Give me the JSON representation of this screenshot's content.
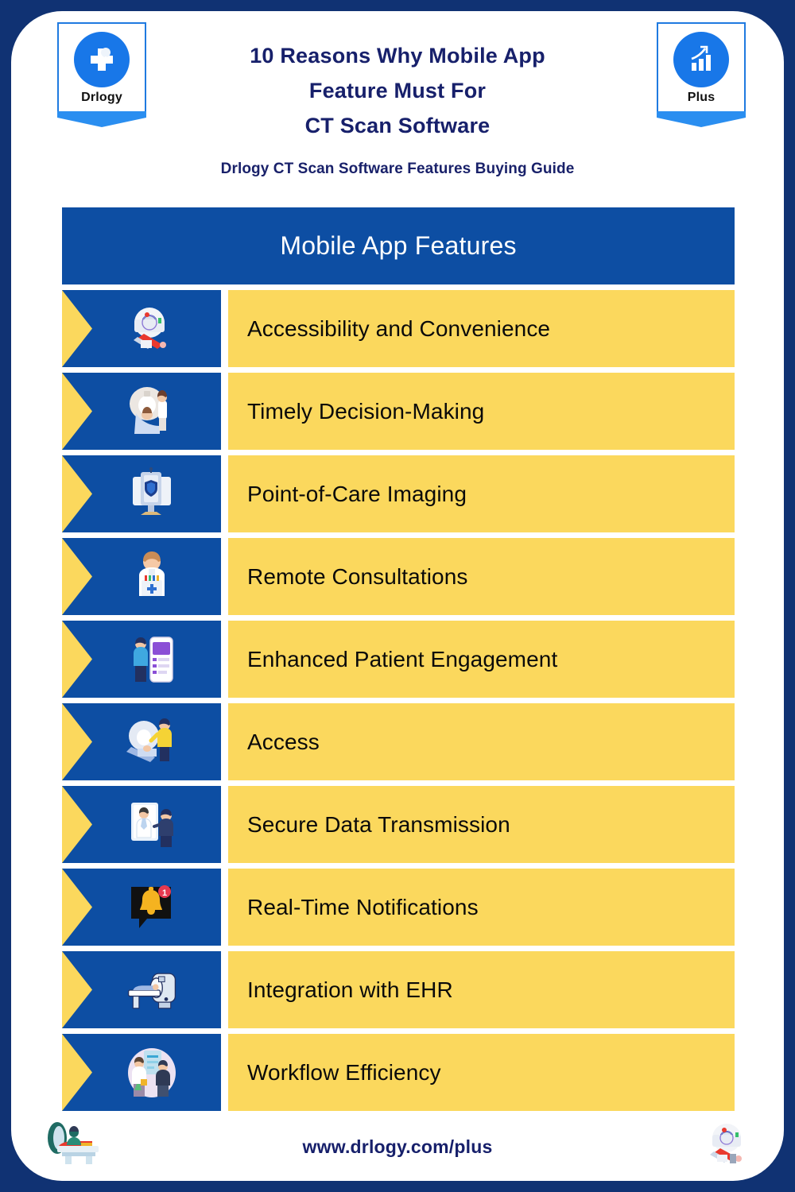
{
  "theme": {
    "outer_border": "#103273",
    "card_bg": "#ffffff",
    "header_blue": "#0d4ea3",
    "row_yellow": "#fbd85d",
    "title_navy": "#17206b",
    "badge_blue": "#1877e8"
  },
  "header": {
    "title_lines": [
      "10 Reasons Why Mobile App",
      "Feature Must For",
      "CT Scan Software"
    ],
    "subtitle": "Drlogy CT Scan Software Features Buying Guide",
    "left_badge": {
      "name": "Drlogy",
      "icon": "medical-cross-stethoscope-icon"
    },
    "right_badge": {
      "name": "Plus",
      "icon": "growth-bar-chart-arrow-icon"
    }
  },
  "table": {
    "header_label": "Mobile App Features",
    "rows": [
      {
        "label": "Accessibility and Convenience",
        "icon": "ct-scanner-patient-icon"
      },
      {
        "label": "Timely Decision-Making",
        "icon": "ct-scanner-technician-icon"
      },
      {
        "label": "Point-of-Care Imaging",
        "icon": "monitor-secure-scan-icon"
      },
      {
        "label": "Remote Consultations",
        "icon": "doctor-medical-kit-icon"
      },
      {
        "label": "Enhanced Patient Engagement",
        "icon": "mobile-app-patient-icon"
      },
      {
        "label": "Access",
        "icon": "ct-scanner-nurse-icon"
      },
      {
        "label": "Secure Data Transmission",
        "icon": "telemedicine-screen-icon"
      },
      {
        "label": "Real-Time Notifications",
        "icon": "bell-notification-badge-icon"
      },
      {
        "label": "Integration with EHR",
        "icon": "mri-machine-patient-icon"
      },
      {
        "label": "Workflow Efficiency",
        "icon": "clinic-workflow-staff-icon"
      }
    ]
  },
  "footer": {
    "url": "www.drlogy.com/plus",
    "left_icon": "ct-scan-patient-table-icon",
    "right_icon": "ct-scanner-isometric-icon"
  }
}
